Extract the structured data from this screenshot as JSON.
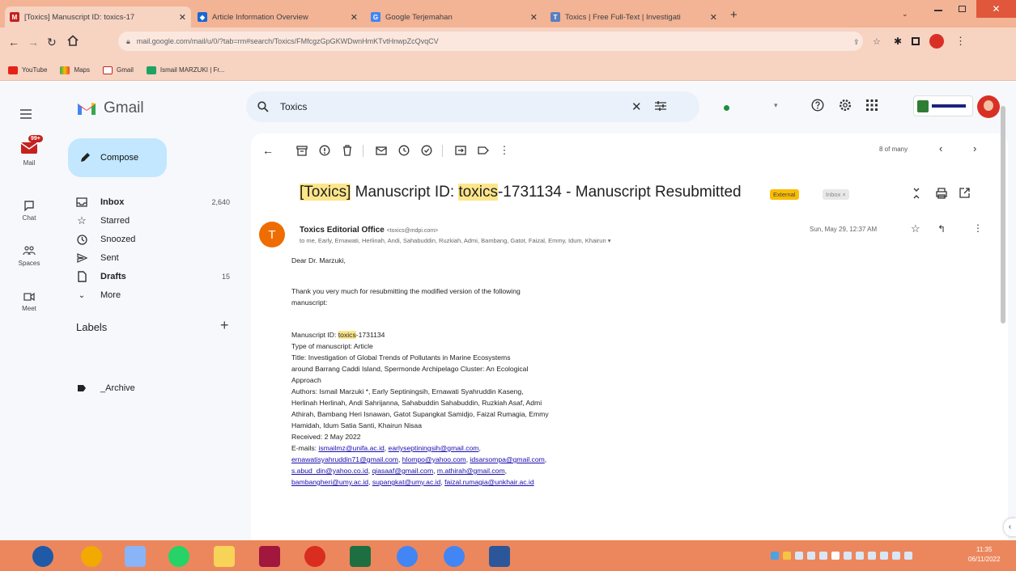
{
  "browser": {
    "tabs": [
      {
        "label": "[Toxics] Manuscript ID: toxics-17",
        "color": "#c5221f",
        "fav": "M"
      },
      {
        "label": "Article Information Overview",
        "color": "#1967d2",
        "fav": "◆"
      },
      {
        "label": "Google Terjemahan",
        "color": "#4285f4",
        "fav": "G"
      },
      {
        "label": "Toxics | Free Full-Text | Investigati",
        "color": "#5b7fbe",
        "fav": "T"
      }
    ],
    "url": "mail.google.com/mail/u/0/?tab=rm#search/Toxics/FMfcgzGpGKWDwnHmKTvtHnwpZcQvqCV",
    "bookmarks": [
      "YouTube",
      "Maps",
      "Gmail",
      "Ismail MARZUKI | Fr..."
    ]
  },
  "rail": {
    "mail_label": "Mail",
    "badge": "99+",
    "chat_label": "Chat",
    "spaces_label": "Spaces",
    "meet_label": "Meet"
  },
  "gmail": {
    "brand": "Gmail",
    "compose": "Compose"
  },
  "nav": {
    "items": [
      {
        "label": "Inbox",
        "count": "2,640",
        "bold": true
      },
      {
        "label": "Starred",
        "count": "",
        "bold": false
      },
      {
        "label": "Snoozed",
        "count": "",
        "bold": false
      },
      {
        "label": "Sent",
        "count": "",
        "bold": false
      },
      {
        "label": "Drafts",
        "count": "15",
        "bold": true
      },
      {
        "label": "More",
        "count": "",
        "bold": false
      }
    ],
    "labels_heading": "Labels",
    "labels": [
      "_Archive"
    ]
  },
  "search": {
    "query": "Toxics"
  },
  "message": {
    "position": "8 of many",
    "subject_prefix": "[Toxics]",
    "subject_rest_1": " Manuscript ID: ",
    "subject_hl": "toxics",
    "subject_rest_2": "-1731134 - Manuscript Resubmitted",
    "badge_external": "External",
    "badge_inbox": "Inbox ×",
    "sender": "Toxics Editorial Office",
    "sender_email": "<toxics@mdpi.com>",
    "recipients": "to me, Early, Ernawati, Herlinah, Andi, Sahabuddin, Ruzkiah, Admi, Bambang, Gatot, Faizal, Emmy, Idum, Khairun ▾",
    "date": "Sun, May 29, 12:37 AM",
    "avatar_letter": "T",
    "greeting": "Dear Dr. Marzuki,",
    "para1_line1": "Thank you very much for resubmitting the modified version of the following",
    "para1_line2": "manuscript:",
    "ms_label": "Manuscript ID: ",
    "ms_hl": "toxics",
    "ms_rest": "-1731134",
    "type_line": "Type of manuscript: Article",
    "title_lines": [
      "Title: Investigation  of Global Trends of Pollutants in Marine Ecosystems",
      "around Barrang Caddi Island, Spermonde Archipelago Cluster: An Ecological",
      "Approach"
    ],
    "author_lines": [
      "Authors: Ismail Marzuki *, Early Septiningsih, Ernawati Syahruddin Kaseng,",
      "Herlinah Herlinah, Andi Sahrijanna, Sahabuddin Sahabuddin, Ruzkiah Asaf, Admi",
      "Athirah, Bambang Heri Isnawan, Gatot Supangkat Samidjo, Faizal Rumagia, Emmy",
      "Hamidah, Idum Satia Santi, Khairun Nisaa"
    ],
    "received": "Received: 2 May 2022",
    "emails_label": "E-mails: ",
    "email_lines": [
      [
        "ismailmz@unifa.ac.id",
        "earlyseptiningsih@gmail.com"
      ],
      [
        "ernawatisyahruddin71@gmail.com",
        "hlompo@yahoo.com",
        "idsarsompa@gmail.com"
      ],
      [
        "s.abud_din@yahoo.co.id",
        "qiasaaf@gmail.com",
        "m.athirah@gmail.com"
      ],
      [
        "bambangheri@umy.ac.id",
        "supangkat@umy.ac.id",
        "faizal.rumagia@unkhair.ac.id"
      ]
    ]
  },
  "taskbar": {
    "time": "11:35",
    "date": "06/11/2022"
  },
  "colors": {
    "accent": "#c5221f",
    "highlight": "#fde68a",
    "compose_bg": "#c2e7ff",
    "taskbar": "#ec875d",
    "tabstrip": "#f3b395"
  }
}
